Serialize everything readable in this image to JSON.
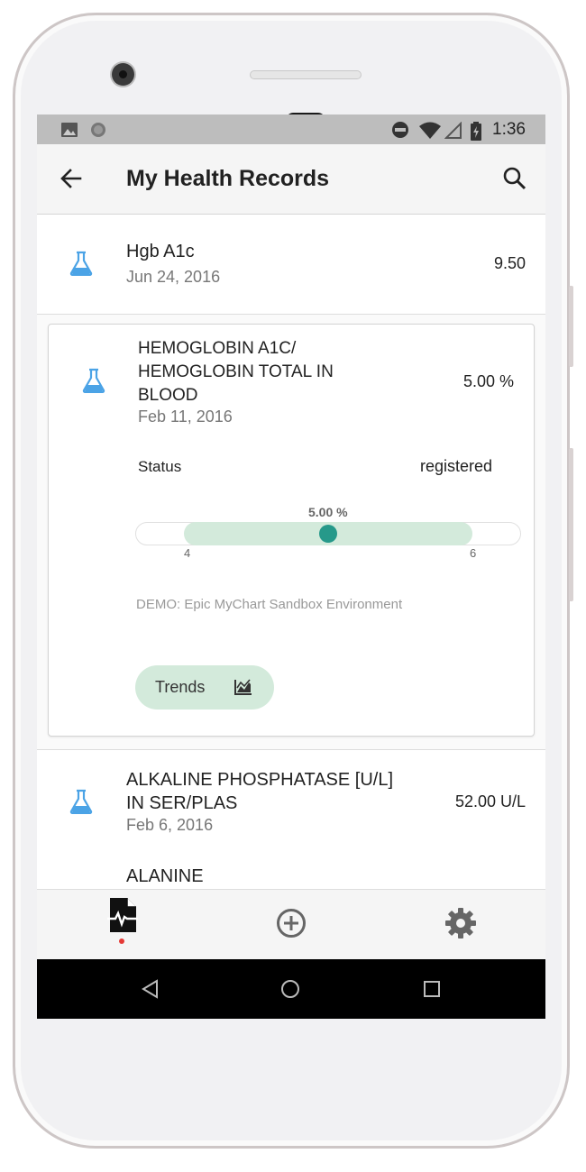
{
  "status_bar": {
    "time": "1:36"
  },
  "app_bar": {
    "title": "My Health Records"
  },
  "records": [
    {
      "name": "Hgb A1c",
      "date": "Jun 24, 2016",
      "value": "9.50"
    },
    {
      "name": "HEMOGLOBIN A1C/ HEMOGLOBIN TOTAL IN BLOOD",
      "date": "Feb 11, 2016",
      "value": "5.00 %",
      "status_label": "Status",
      "status_value": "registered",
      "range": {
        "current_label": "5.00 %",
        "low": "4",
        "high": "6",
        "current": 5.0,
        "min": 4,
        "max": 6
      },
      "source": "DEMO: Epic MyChart Sandbox Environment",
      "trends_label": "Trends"
    },
    {
      "name": "ALKALINE PHOSPHATASE [U/L] IN SER/PLAS",
      "date": "Feb 6, 2016",
      "value": "52.00 U/L"
    },
    {
      "name": "ALANINE"
    }
  ],
  "bottom_nav": [
    "health-records",
    "add",
    "settings"
  ],
  "colors": {
    "flask": "#4ba3e6",
    "accent": "#26998a",
    "range_fill": "#d3eadb",
    "notification": "#e53935"
  }
}
